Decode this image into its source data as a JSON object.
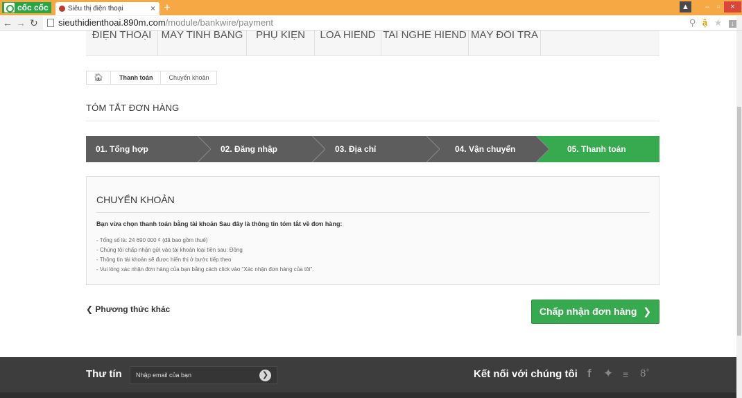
{
  "browser": {
    "brand": "cốc cốc",
    "tab_title": "Siêu thị điện thoại",
    "tab_close": "×",
    "new_tab": "+",
    "url_host": "sieuthidienthoai.890m.com",
    "url_path": "/module/bankwire/payment",
    "window_buttons": {
      "minimize": "–",
      "maximize": "▫",
      "close": "×"
    }
  },
  "topnav": {
    "items": [
      "ĐIỆN THOẠI",
      "MÁY TÍNH BẢNG",
      "PHỤ KIỆN",
      "LOA HIEND",
      "TAI NGHE HIEND",
      "MÁY ĐỔI TRẢ"
    ]
  },
  "breadcrumb": {
    "home_icon": "home-icon",
    "items": [
      "Thanh toán",
      "Chuyển khoản"
    ]
  },
  "order_summary_title": "TÓM TẮT ĐƠN HÀNG",
  "steps": [
    {
      "label": "01. Tổng hợp",
      "state": "pending"
    },
    {
      "label": "02. Đăng nhập",
      "state": "pending"
    },
    {
      "label": "03. Địa chỉ",
      "state": "pending"
    },
    {
      "label": "04. Vận chuyển",
      "state": "pending"
    },
    {
      "label": "05. Thanh toán",
      "state": "current"
    }
  ],
  "panel": {
    "title": "CHUYỂN KHOẢN",
    "lead": "Bạn vừa chọn thanh toán bằng tài khoản Sau đây là thông tin tóm tắt về đơn hàng:",
    "lines": [
      "- Tổng số là: 24 690 000 ₫ (đã bao gồm thuế)",
      "- Chúng tôi chấp nhận gửi vào tài khoản loại tiền sau: Đồng",
      "- Thông tin tài khoản sẽ được hiển thị ở bước tiếp theo",
      "- Vui lòng xác nhận đơn hàng của bạn bằng cách click vào \"Xác nhận đơn hàng của tôi\"."
    ]
  },
  "actions": {
    "back_label": "Phương thức khác",
    "accept_label": "Chấp nhận đơn hàng"
  },
  "footer": {
    "newsletter_label": "Thư tín",
    "newsletter_placeholder": "Nhập email của bạn",
    "connect_label": "Kết nối với chúng tôi",
    "social_icons": [
      "facebook-icon",
      "twitter-icon",
      "rss-icon",
      "google-plus-icon"
    ]
  },
  "colors": {
    "accent_green": "#37a94f",
    "step_gray": "#5d5d5d",
    "browser_orange": "#f5a843",
    "footer_dark": "#3d3d3d"
  }
}
